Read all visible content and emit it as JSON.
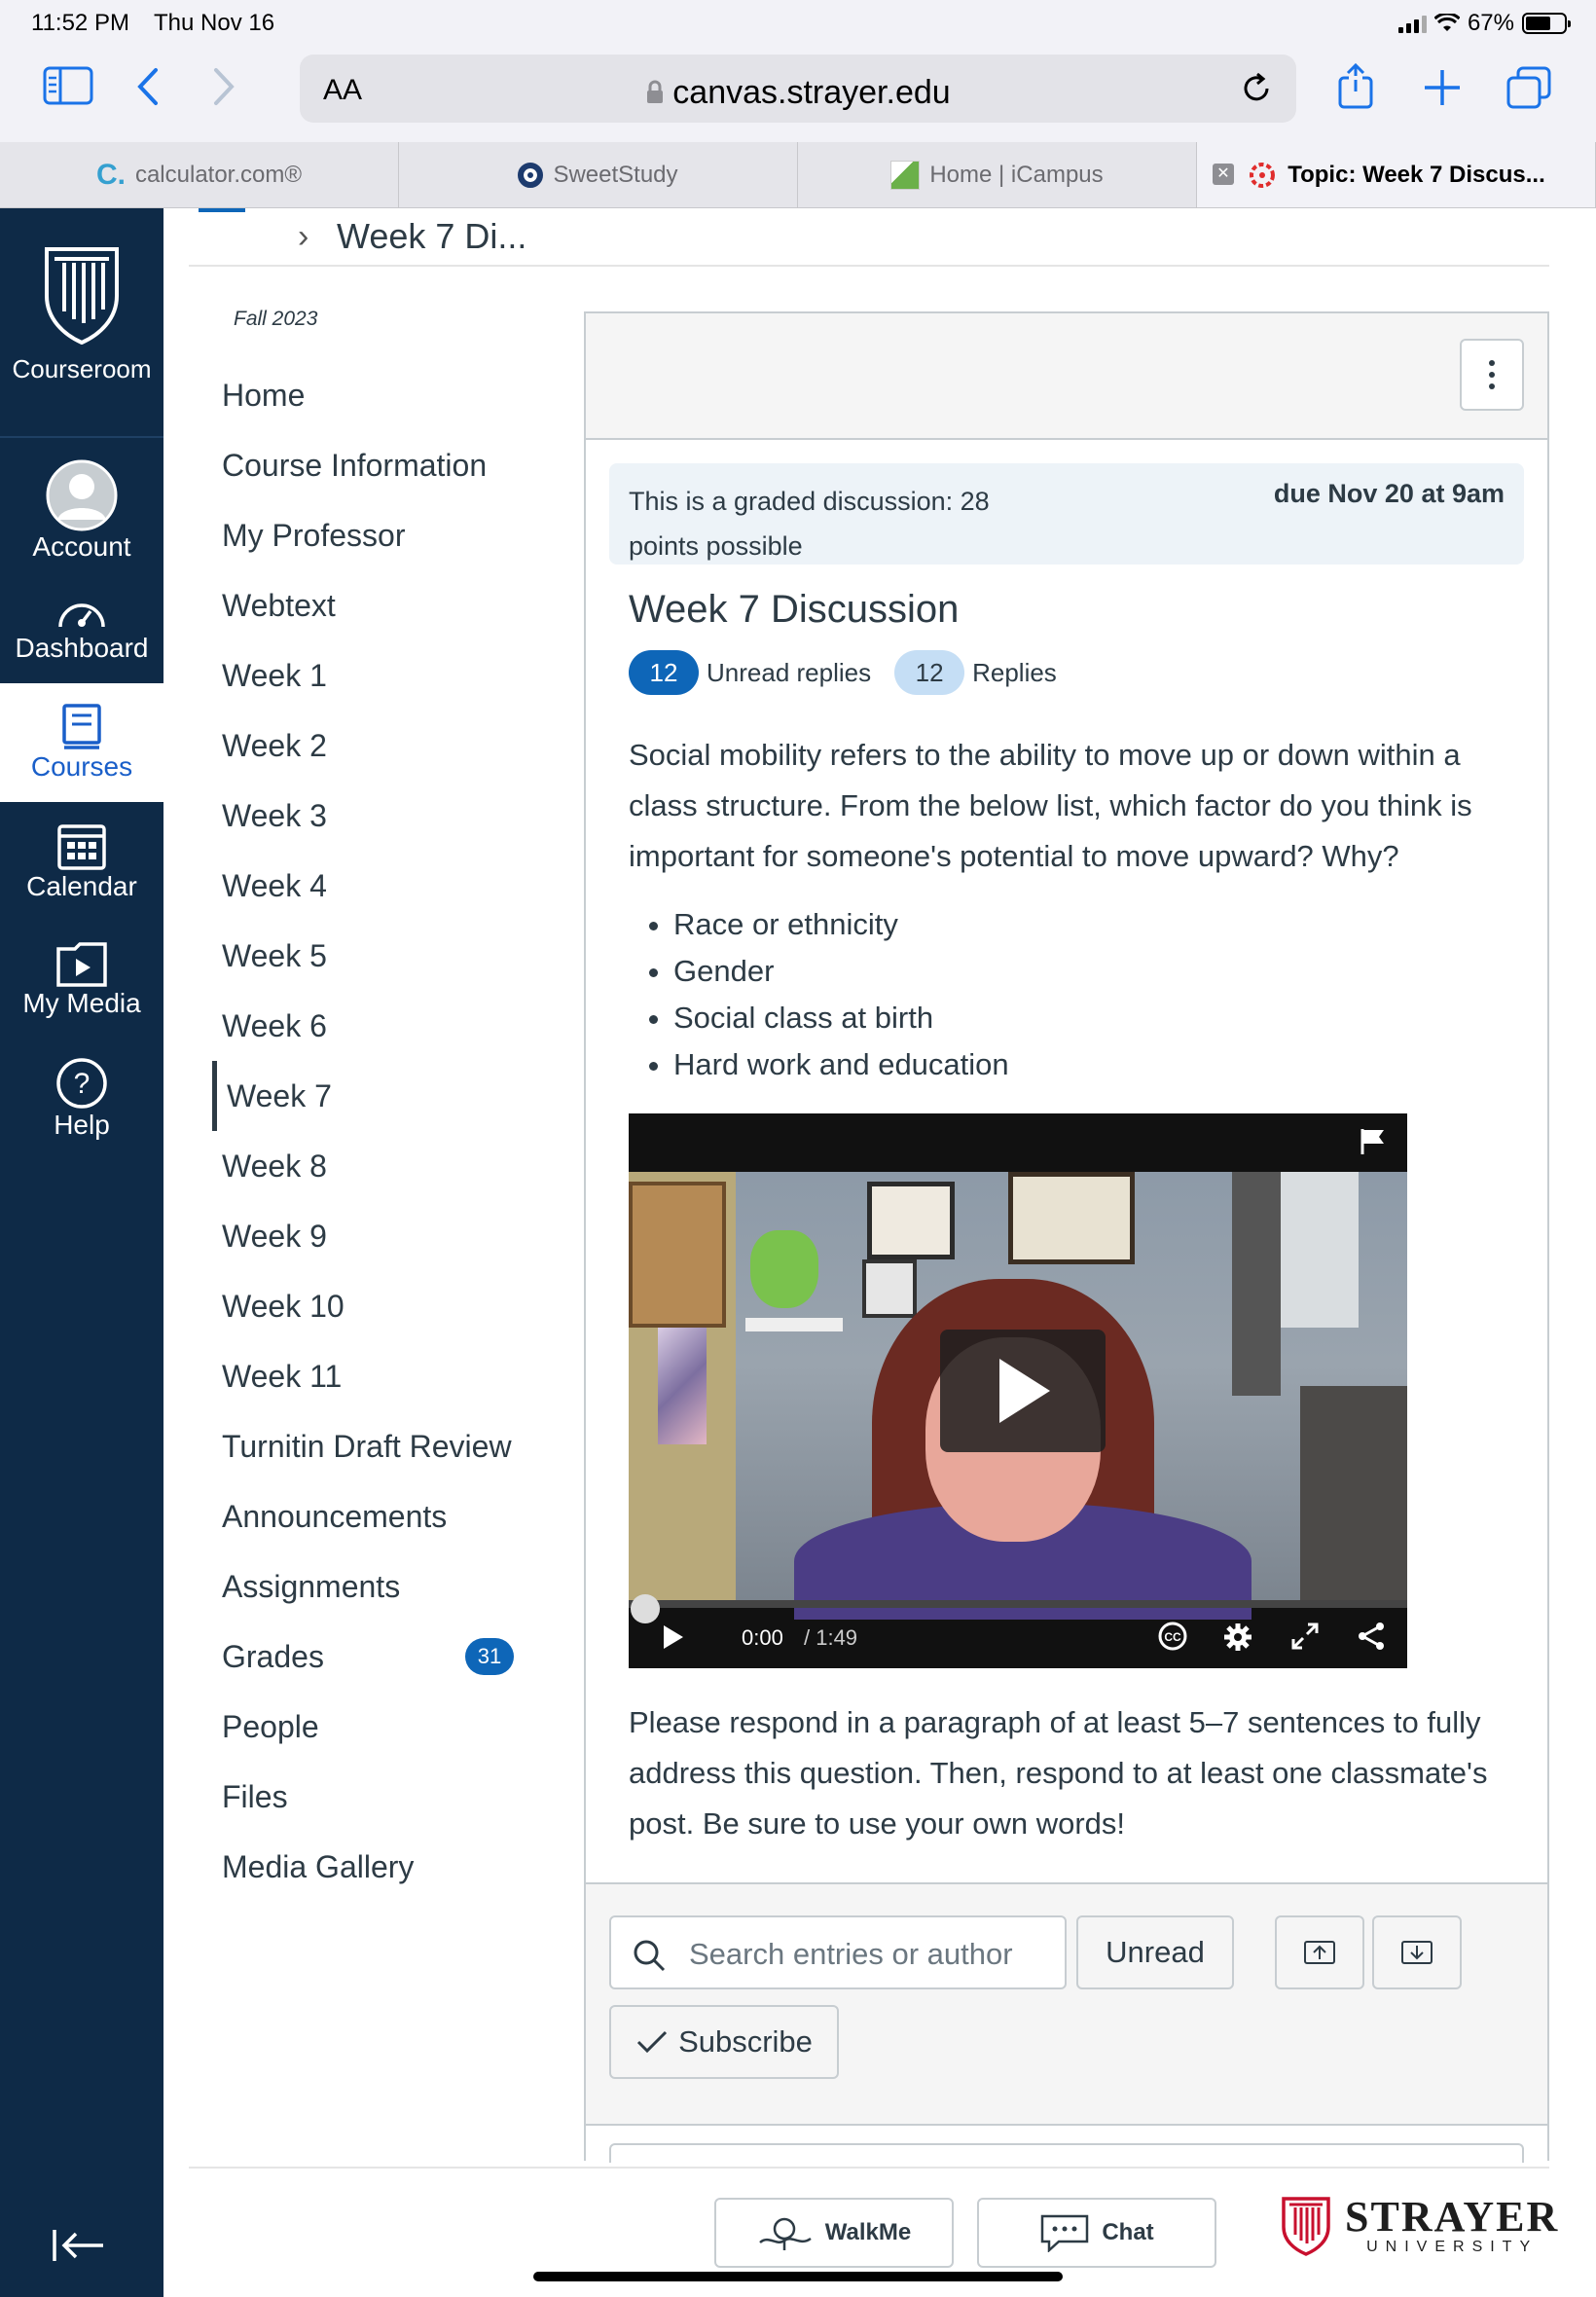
{
  "status_bar": {
    "time": "11:52 PM",
    "date": "Thu Nov 16",
    "battery": "67%"
  },
  "browser": {
    "aa_label": "AA",
    "url": "canvas.strayer.edu",
    "tabs": [
      {
        "label": "calculator.com®"
      },
      {
        "label": "SweetStudy"
      },
      {
        "label": "Home | iCampus"
      },
      {
        "label": "Topic: Week 7 Discus..."
      }
    ]
  },
  "global_nav": {
    "brand_label": "Courseroom",
    "items": [
      {
        "label": "Account"
      },
      {
        "label": "Dashboard"
      },
      {
        "label": "Courses"
      },
      {
        "label": "Calendar"
      },
      {
        "label": "My Media"
      },
      {
        "label": "Help"
      }
    ]
  },
  "breadcrumb": {
    "current": "Week 7 Di..."
  },
  "course_nav": {
    "term": "Fall 2023",
    "items": [
      {
        "label": "Home"
      },
      {
        "label": "Course Information"
      },
      {
        "label": "My Professor"
      },
      {
        "label": "Webtext"
      },
      {
        "label": "Week 1"
      },
      {
        "label": "Week 2"
      },
      {
        "label": "Week 3"
      },
      {
        "label": "Week 4"
      },
      {
        "label": "Week 5"
      },
      {
        "label": "Week 6"
      },
      {
        "label": "Week 7"
      },
      {
        "label": "Week 8"
      },
      {
        "label": "Week 9"
      },
      {
        "label": "Week 10"
      },
      {
        "label": "Week 11"
      },
      {
        "label": "Turnitin Draft Review"
      },
      {
        "label": "Announcements"
      },
      {
        "label": "Assignments"
      },
      {
        "label": "Grades",
        "badge": "31"
      },
      {
        "label": "People"
      },
      {
        "label": "Files"
      },
      {
        "label": "Media Gallery"
      }
    ]
  },
  "discussion": {
    "graded_notice": "This is a graded discussion: 28 points possible",
    "due": "due Nov 20 at 9am",
    "title": "Week 7 Discussion",
    "unread_count": "12",
    "unread_label": "Unread replies",
    "replies_count": "12",
    "replies_label": "Replies",
    "prompt": "Social mobility refers to the ability to move up or down within a class structure. From the below list, which factor do you think is important for someone's potential to move upward? Why?",
    "factors": [
      "Race or ethnicity",
      "Gender",
      "Social class at birth",
      "Hard work and education"
    ],
    "video": {
      "current_time": "0:00",
      "duration": "/ 1:49",
      "progress": 0
    },
    "instructions": "Please respond in a paragraph of at least 5–7 sentences to fully address this question. Then, respond to at least one classmate's post. Be sure to use your own words!"
  },
  "controls": {
    "search_placeholder": "Search entries or author",
    "unread_button": "Unread",
    "subscribe_button": "Subscribe"
  },
  "footer": {
    "walkme_label": "WalkMe",
    "chat_label": "Chat",
    "logo_word": "STRAYER",
    "logo_sub": "UNIVERSITY"
  },
  "colors": {
    "nav_bg": "#0e2a47",
    "link_blue": "#0e66b8",
    "safari_blue": "#1a73e8",
    "strayer_red": "#c8102e"
  }
}
